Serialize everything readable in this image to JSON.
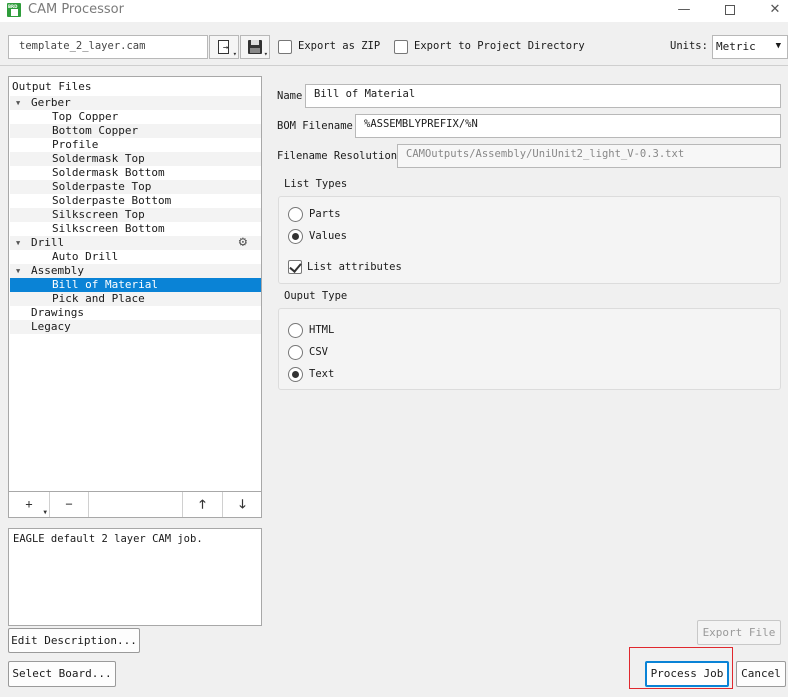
{
  "window": {
    "title": "CAM Processor",
    "minimize": "—",
    "close": "✕"
  },
  "toolbar": {
    "job_file": "template_2_layer.cam",
    "export_zip_label": "Export as ZIP",
    "export_zip_checked": false,
    "export_project_label": "Export to Project Directory",
    "export_project_checked": false,
    "units_label": "Units:",
    "units_value": "Metric"
  },
  "tree": {
    "header": "Output Files",
    "items": [
      {
        "label": "Gerber",
        "level": 0,
        "expanded": true
      },
      {
        "label": "Top Copper",
        "level": 1
      },
      {
        "label": "Bottom Copper",
        "level": 1
      },
      {
        "label": "Profile",
        "level": 1
      },
      {
        "label": "Soldermask Top",
        "level": 1
      },
      {
        "label": "Soldermask Bottom",
        "level": 1
      },
      {
        "label": "Solderpaste Top",
        "level": 1
      },
      {
        "label": "Solderpaste Bottom",
        "level": 1
      },
      {
        "label": "Silkscreen Top",
        "level": 1
      },
      {
        "label": "Silkscreen Bottom",
        "level": 1
      },
      {
        "label": "Drill",
        "level": 0,
        "expanded": true,
        "gear": true
      },
      {
        "label": "Auto Drill",
        "level": 1
      },
      {
        "label": "Assembly",
        "level": 0,
        "expanded": true
      },
      {
        "label": "Bill of Material",
        "level": 1,
        "selected": true
      },
      {
        "label": "Pick and Place",
        "level": 1
      },
      {
        "label": "Drawings",
        "level": 0
      },
      {
        "label": "Legacy",
        "level": 0
      }
    ],
    "buttons": {
      "add": "+",
      "remove": "−",
      "up": "🡑",
      "down": "🡓"
    }
  },
  "description": "EAGLE default 2 layer CAM job.",
  "edit_description_label": "Edit Description...",
  "select_board_label": "Select Board...",
  "form": {
    "name_label": "Name",
    "name_value": "Bill of Material",
    "bom_label": "BOM Filename",
    "bom_value": "%ASSEMBLYPREFIX/%N",
    "resolution_label": "Filename Resolution",
    "resolution_value": "CAMOutputs/Assembly/UniUnit2_light_V-0.3.txt",
    "list_types_label": "List Types",
    "list_types": [
      {
        "label": "Parts",
        "checked": false
      },
      {
        "label": "Values",
        "checked": true
      }
    ],
    "list_attributes_label": "List attributes",
    "list_attributes_checked": true,
    "output_type_label": "Ouput Type",
    "output_types": [
      {
        "label": "HTML",
        "checked": false
      },
      {
        "label": "CSV",
        "checked": false
      },
      {
        "label": "Text",
        "checked": true
      }
    ]
  },
  "actions": {
    "export_file": "Export File",
    "process_job": "Process Job",
    "cancel": "Cancel"
  },
  "colors": {
    "selection": "#0a83d6",
    "highlight_box": "#e0282e",
    "app_icon": "#2e9d3b"
  }
}
